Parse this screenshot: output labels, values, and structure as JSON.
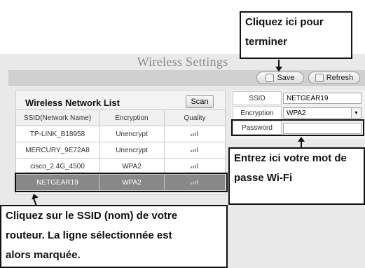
{
  "title": "Wireless Settings",
  "toolbar": {
    "save_label": "Save",
    "refresh_label": "Refresh"
  },
  "network_list": {
    "title": "Wireless Network List",
    "scan_label": "Scan",
    "columns": [
      "SSID(Network Name)",
      "Encryption",
      "Quality"
    ],
    "rows": [
      {
        "ssid": "TP-LINK_B18958",
        "encryption": "Unencrypt",
        "quality": 0.6
      },
      {
        "ssid": "MERCURY_9E72A8",
        "encryption": "Unencrypt",
        "quality": 0.6
      },
      {
        "ssid": "cisco_2.4G_4500",
        "encryption": "WPA2",
        "quality": 0.6
      },
      {
        "ssid": "NETGEAR19",
        "encryption": "WPA2",
        "quality": 0.6,
        "selected": true
      }
    ]
  },
  "form": {
    "ssid_label": "SSID",
    "ssid_value": "NETGEAR19",
    "encryption_label": "Encryption",
    "encryption_value": "WPA2",
    "password_label": "Password",
    "password_value": ""
  },
  "annotations": {
    "finish": [
      "Cliquez ici pour",
      "terminer"
    ],
    "password": [
      "Entrez ici votre mot de",
      "passe Wi-Fi"
    ],
    "ssid": [
      "Cliquez sur le SSID (nom) de votre",
      "routeur. La ligne sélectionnée est",
      "alors marquée."
    ]
  }
}
